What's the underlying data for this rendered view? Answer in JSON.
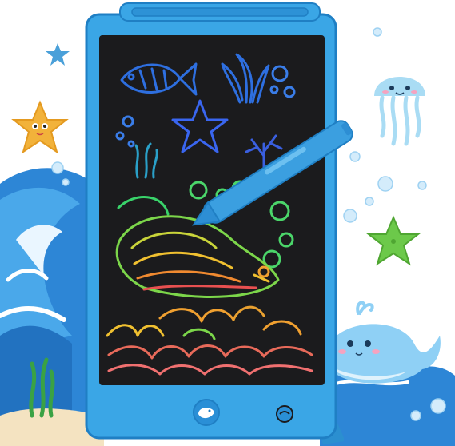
{
  "scene": {
    "subject": "lcd-writing-tablet",
    "theme": "ocean",
    "colors": {
      "frame_blue": "#3aa6e6",
      "frame_dark": "#1f7fc4",
      "screen": "#1b1b1d",
      "wave_blue": "#2d86d6",
      "stylus": "#3b9fe0",
      "starfish_orange": "#f2b23a",
      "starfish_green": "#6cc94a",
      "whale_blue": "#8fd0f5",
      "jellyfish": "#a9dcf4"
    },
    "icons": [
      "fish-drawing",
      "seaweed-drawing",
      "starfish-drawing",
      "coral-drawing",
      "whale-drawing",
      "waves-drawing",
      "stylus",
      "lock-switch",
      "erase-button",
      "starfish",
      "jellyfish",
      "whale",
      "seaweed",
      "bubbles"
    ]
  }
}
